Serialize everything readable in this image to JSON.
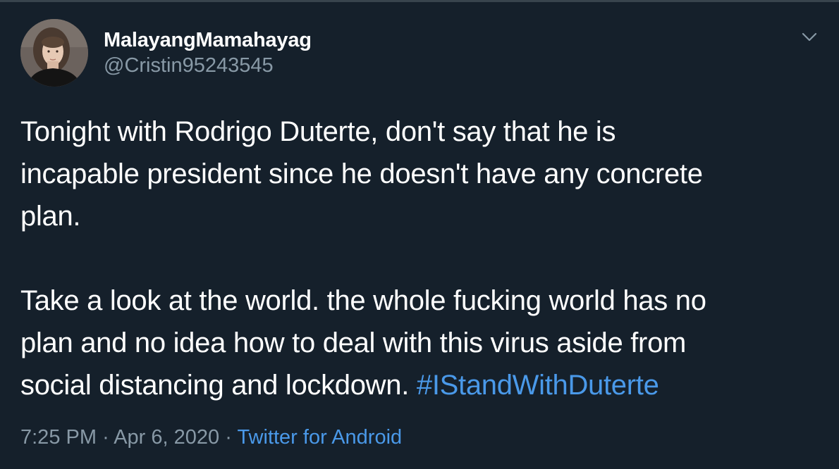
{
  "author": {
    "display_name": "MalayangMamahayag",
    "handle": "@Cristin95243545"
  },
  "tweet": {
    "lines": [
      "Tonight with Rodrigo Duterte, don't say that he is",
      "incapable president since he doesn't have any concrete",
      "plan.",
      "Take a look at the world. the whole fucking world has no",
      "plan and no idea how to deal with this virus aside from",
      "social distancing and lockdown."
    ],
    "hashtag": "#IStandWithDuterte"
  },
  "meta": {
    "time": "7:25 PM",
    "separator": "·",
    "date": "Apr 6, 2020",
    "source": "Twitter for Android"
  },
  "icons": {
    "caret": "chevron-down-icon"
  },
  "colors": {
    "background": "#15202b",
    "primary_text": "#ffffff",
    "secondary_text": "#8899a6",
    "link": "#4a99e9",
    "border": "#38444d"
  }
}
